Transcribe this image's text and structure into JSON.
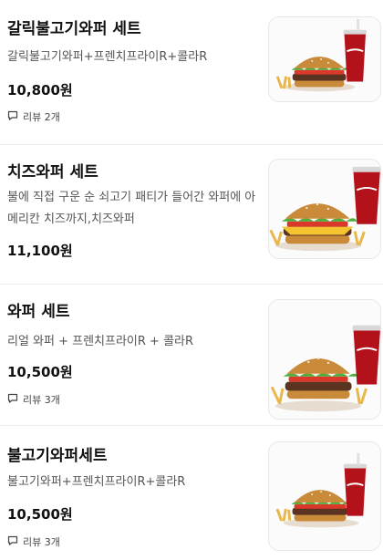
{
  "menu": {
    "items": [
      {
        "name": "갈릭불고기와퍼 세트",
        "description": "갈릭불고기와퍼+프렌치프라이R+콜라R",
        "price": "10,800원",
        "review_count": "리뷰 2개",
        "image_icon": "burger-set-photo"
      },
      {
        "name": "치즈와퍼 세트",
        "description": "불에 직접 구운 순 쇠고기 패티가 들어간 와퍼에 아메리칸 치즈까지,치즈와퍼",
        "price": "11,100원",
        "review_count": "",
        "image_icon": "burger-set-photo"
      },
      {
        "name": "와퍼 세트",
        "description": "리얼 와퍼 + 프렌치프라이R + 콜라R",
        "price": "10,500원",
        "review_count": "리뷰 3개",
        "image_icon": "burger-set-photo"
      },
      {
        "name": "불고기와퍼세트",
        "description": "불고기와퍼+프렌치프라이R+콜라R",
        "price": "10,500원",
        "review_count": "리뷰 3개",
        "image_icon": "burger-set-photo"
      }
    ],
    "review_icon": "speech-bubble-icon",
    "colors": {
      "bun": "#c98a3a",
      "lettuce": "#4caf3c",
      "tomato": "#d9382b",
      "cheese": "#f4c430",
      "patty": "#5a3420",
      "cola": "#b3121b",
      "fries": "#e8b64a"
    }
  }
}
